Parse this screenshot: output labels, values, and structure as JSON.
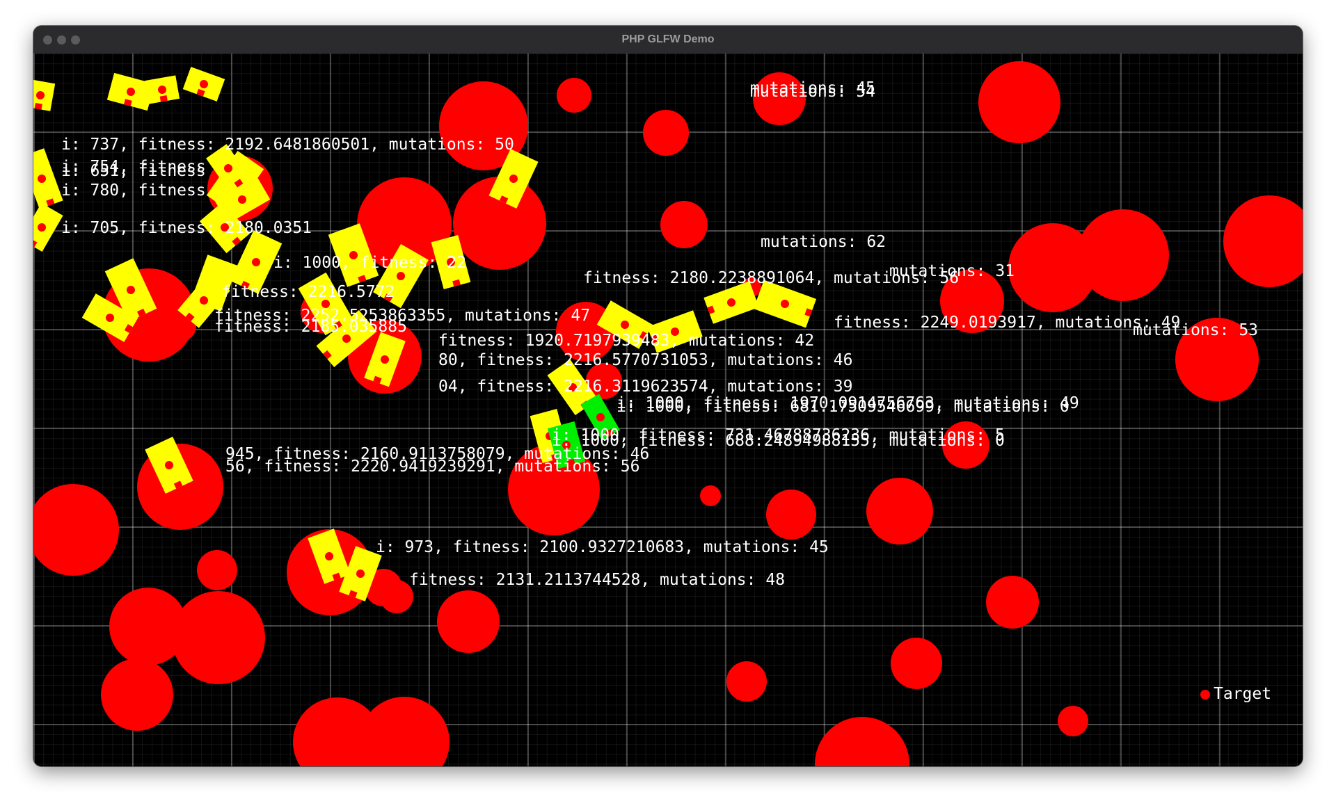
{
  "window": {
    "title": "PHP GLFW Demo"
  },
  "colors": {
    "background": "#000000",
    "obstacle": "#ff0000",
    "agent": "#ffff00",
    "agent_best": "#00ee00",
    "agent_marker": "#ff0000",
    "text": "#ffffff",
    "titlebar": "#2b2b2d"
  },
  "target_label": "Target",
  "agent_labels": [
    "i: 737, fitness: 2192.6481860501, mutations: 50",
    "i: 754, fitness",
    "i: 651, fitness",
    "i: 780, fitness",
    "i: 705, fitness: 2180.0351",
    "i: 1000, fitness: 22",
    "fitness: 2216.5772",
    "fitness: 2252.5253863355, mutations: 47",
    "fitness: 2185.035885",
    "fitness: 1920.7197939483, mutations: 42",
    "80, fitness: 2216.5770731053, mutations: 46",
    "04, fitness: 2216.3119623574, mutations: 39",
    "i: 1000, fitness: 1970.0914756763, mutations: 49",
    "i: 1000, fitness: 681.17509546699, mutations: 0",
    "i: 1000, fitness: 731.46788736236, mutations: 5",
    "i: 1000, fitness: 688.24894988155, mutations: 0",
    "945, fitness: 2160.9113758079, mutations: 46",
    "56, fitness: 2220.9419239291, mutations: 56",
    "i: 973, fitness: 2100.9327210683, mutations: 45",
    "fitness: 2131.2113744528, mutations: 48",
    "mutations: 62",
    "mutations: 31",
    "fitness: 2180.2238891064, mutations: 56",
    "fitness: 2249.0193917, mutations: 49",
    "mutations: 53",
    "mutations: 45",
    "mutations: 54"
  ]
}
